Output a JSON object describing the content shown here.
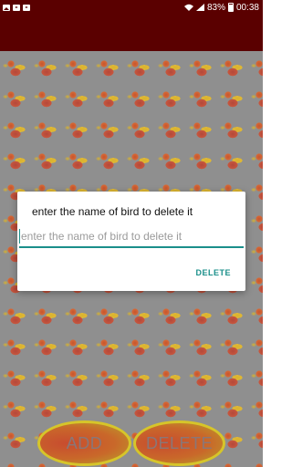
{
  "status_bar": {
    "left_icons": [
      "image-icon",
      "youtube-icon",
      "youtube-icon"
    ],
    "battery": "83%",
    "time": "00:38"
  },
  "dialog": {
    "title": "enter the name of bird to delete it",
    "input_placeholder": "enter the name of bird to delete it",
    "input_value": "",
    "action_label": "DELETE",
    "accent_color": "#1a8f8a"
  },
  "buttons": {
    "add_label": "ADD",
    "delete_label": "DELETE"
  },
  "colors": {
    "app_bar": "#5a0000",
    "button_border": "#d6c52a"
  }
}
